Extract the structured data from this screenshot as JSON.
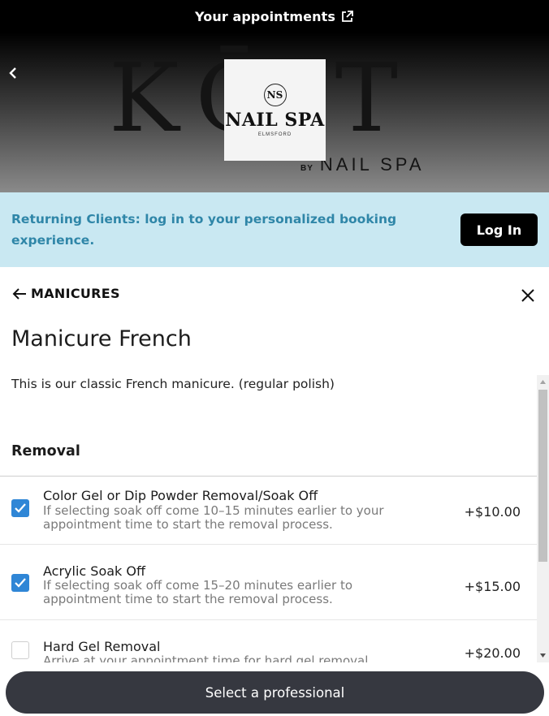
{
  "header": {
    "title": "Your appointments",
    "external_icon": "external-link-icon"
  },
  "hero": {
    "brand_big": "KŌ T",
    "brand_by": "BY",
    "brand_sub": "NAIL SPA",
    "logo": {
      "monogram": "NS",
      "name": "NAIL SPA",
      "location": "ELMSFORD"
    }
  },
  "banner": {
    "message": "Returning Clients: log in to your personalized booking experience.",
    "login_label": "Log In"
  },
  "nav": {
    "breadcrumb": "MANICURES"
  },
  "service": {
    "title": "Manicure French",
    "description": "This is our classic French manicure. (regular polish)"
  },
  "section": {
    "title": "Removal"
  },
  "options": [
    {
      "name": "Color Gel or Dip Powder Removal/Soak Off",
      "note": "If selecting soak off come 10–15 minutes earlier to your appointment time to start the removal process.",
      "price": "+$10.00",
      "checked": true
    },
    {
      "name": "Acrylic Soak Off",
      "note": "If selecting soak off come 15–20 minutes earlier to appointment time to start the removal process.",
      "price": "+$15.00",
      "checked": true
    },
    {
      "name": "Hard Gel Removal",
      "note": "Arrive at your appointment time for hard gel removal",
      "price": "+$20.00",
      "checked": false
    }
  ],
  "cta": {
    "label": "Select a professional"
  },
  "colors": {
    "banner_bg": "#c9e8f2",
    "banner_text": "#2f86a8",
    "checkbox": "#2f86d6",
    "cta_bg": "#363840"
  }
}
